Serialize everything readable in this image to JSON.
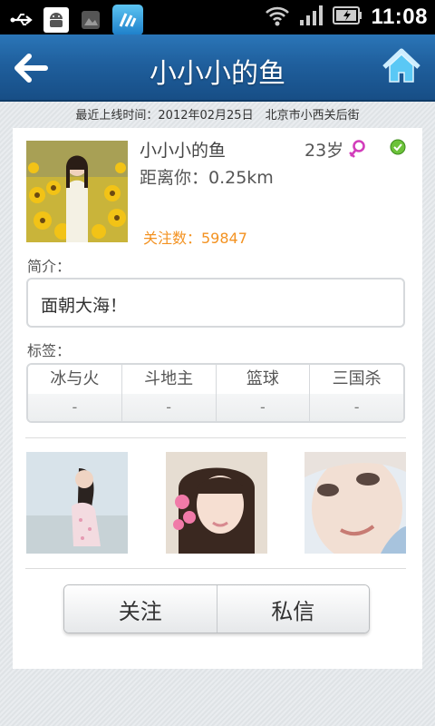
{
  "status_bar": {
    "time": "11:08",
    "left_icons": [
      "usb-icon",
      "android-debug-icon",
      "image-notify-icon",
      "app-notify-icon"
    ],
    "right_icons": [
      "wifi-icon",
      "signal-icon",
      "battery-charging-icon"
    ]
  },
  "header": {
    "title": "小小小的鱼",
    "back_icon": "back-arrow-icon",
    "home_icon": "home-icon"
  },
  "info_line": "最近上线时间：2012年02月25日　北京市小西关后街",
  "profile": {
    "name": "小小小的鱼",
    "age": "23岁",
    "gender_icon": "female-icon",
    "online_icon": "online-check-icon",
    "distance": "距离你：0.25km",
    "follow_count": "关注数：59847"
  },
  "intro": {
    "label": "简介：",
    "text": "面朝大海！"
  },
  "tags": {
    "label": "标签：",
    "items": [
      {
        "name": "冰与火",
        "value": "-"
      },
      {
        "name": "斗地主",
        "value": "-"
      },
      {
        "name": "篮球",
        "value": "-"
      },
      {
        "name": "三国杀",
        "value": "-"
      }
    ]
  },
  "photos": [
    "photo-1",
    "photo-2",
    "photo-3"
  ],
  "actions": {
    "follow": "关注",
    "message": "私信"
  },
  "colors": {
    "title_bar": "#1f5f9d",
    "follow_count": "#f39221",
    "accent_blue": "#5ac8f5"
  }
}
